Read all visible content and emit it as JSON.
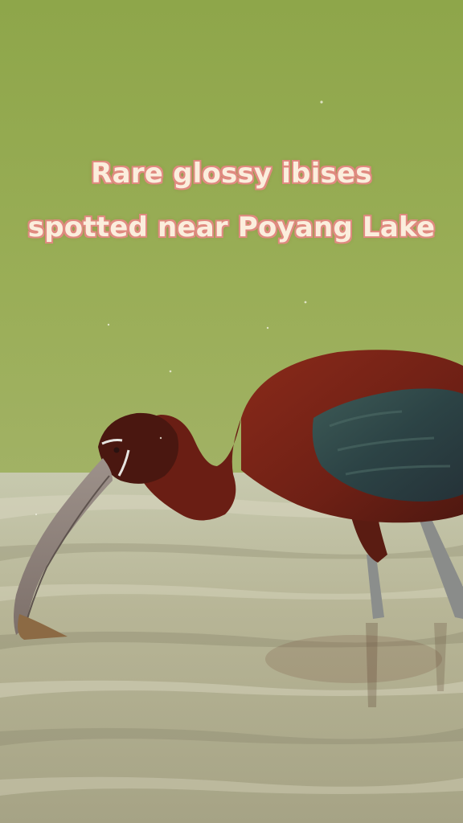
{
  "caption": {
    "line1": "Rare glossy ibises",
    "line2": "spotted near Poyang Lake"
  },
  "scene": {
    "subject": "glossy-ibis",
    "colors": {
      "background_green": "#93a84e",
      "water": "#c9c4ad",
      "plumage_chestnut": "#7c2418",
      "wing_iridescent": "#2f4a4d",
      "bill": "#8d7f76",
      "caption_text": "#fbeedd",
      "caption_outline": "#e08a80"
    }
  }
}
